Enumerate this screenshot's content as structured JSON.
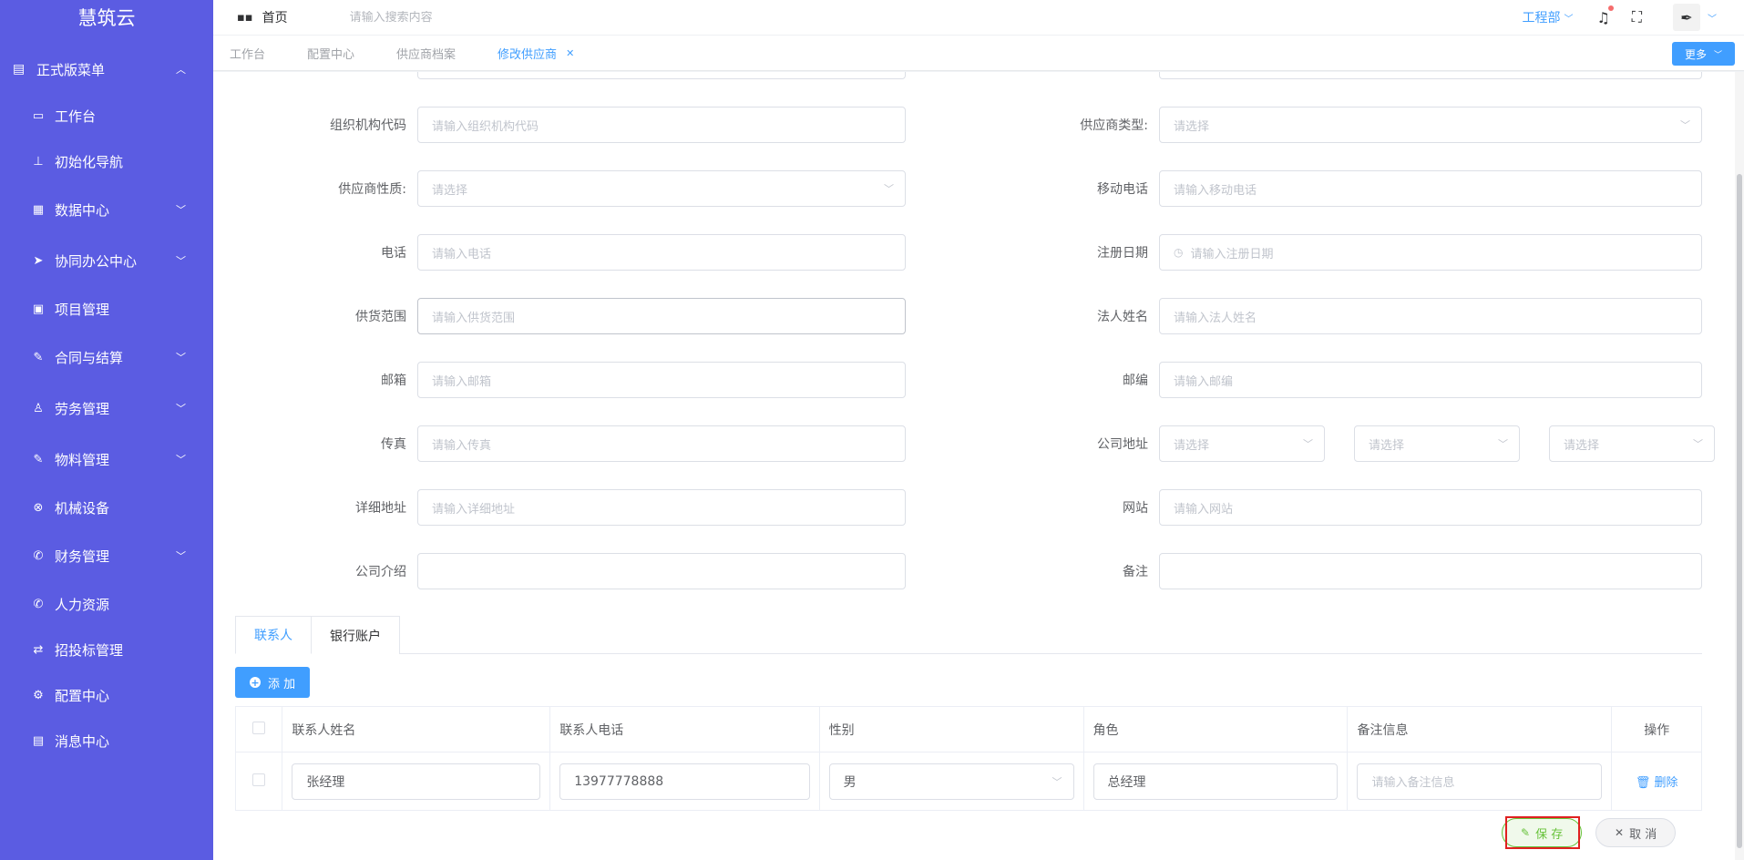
{
  "sidebar": {
    "logo": "慧筑云",
    "group": "正式版菜单",
    "items": [
      {
        "label": "工作台",
        "icon": "monitor-icon",
        "glyph": "▭",
        "arrow": false
      },
      {
        "label": "初始化导航",
        "icon": "sitemap-icon",
        "glyph": "⊥",
        "arrow": false
      },
      {
        "label": "数据中心",
        "icon": "grid-icon",
        "glyph": "▦",
        "arrow": true
      },
      {
        "label": "协同办公中心",
        "icon": "send-icon",
        "glyph": "➤",
        "arrow": true
      },
      {
        "label": "项目管理",
        "icon": "book-icon",
        "glyph": "▣",
        "arrow": false
      },
      {
        "label": "合同与结算",
        "icon": "edit-doc-icon",
        "glyph": "✎",
        "arrow": true
      },
      {
        "label": "劳务管理",
        "icon": "user-stamp-icon",
        "glyph": "♙",
        "arrow": true
      },
      {
        "label": "物料管理",
        "icon": "edit-icon",
        "glyph": "✎",
        "arrow": true
      },
      {
        "label": "机械设备",
        "icon": "circle-x-icon",
        "glyph": "⊗",
        "arrow": false
      },
      {
        "label": "财务管理",
        "icon": "phone-icon",
        "glyph": "✆",
        "arrow": true
      },
      {
        "label": "人力资源",
        "icon": "phone-call-icon",
        "glyph": "✆",
        "arrow": false
      },
      {
        "label": "招投标管理",
        "icon": "switch-icon",
        "glyph": "⇄",
        "arrow": false
      },
      {
        "label": "配置中心",
        "icon": "gear-icon",
        "glyph": "⚙",
        "arrow": false
      },
      {
        "label": "消息中心",
        "icon": "message-icon",
        "glyph": "▤",
        "arrow": false
      }
    ]
  },
  "header": {
    "home": "首页",
    "search_placeholder": "请输入搜索内容",
    "dept": "工程部"
  },
  "tabs": [
    {
      "label": "工作台",
      "active": false
    },
    {
      "label": "配置中心",
      "active": false
    },
    {
      "label": "供应商档案",
      "active": false
    },
    {
      "label": "修改供应商",
      "active": true
    }
  ],
  "more_label": "更多",
  "form": {
    "org_code": {
      "label": "组织机构代码",
      "placeholder": "请输入组织机构代码"
    },
    "supplier_type": {
      "label": "供应商类型:",
      "placeholder": "请选择"
    },
    "supplier_nature": {
      "label": "供应商性质:",
      "placeholder": "请选择"
    },
    "mobile": {
      "label": "移动电话",
      "placeholder": "请输入移动电话"
    },
    "phone": {
      "label": "电话",
      "placeholder": "请输入电话"
    },
    "reg_date": {
      "label": "注册日期",
      "placeholder": "请输入注册日期"
    },
    "supply_scope": {
      "label": "供货范围",
      "placeholder": "请输入供货范围"
    },
    "legal_name": {
      "label": "法人姓名",
      "placeholder": "请输入法人姓名"
    },
    "email": {
      "label": "邮箱",
      "placeholder": "请输入邮箱"
    },
    "zipcode": {
      "label": "邮编",
      "placeholder": "请输入邮编"
    },
    "fax": {
      "label": "传真",
      "placeholder": "请输入传真"
    },
    "company_address": {
      "label": "公司地址",
      "placeholder1": "请选择",
      "placeholder2": "请选择",
      "placeholder3": "请选择"
    },
    "detail_address": {
      "label": "详细地址",
      "placeholder": "请输入详细地址"
    },
    "website": {
      "label": "网站",
      "placeholder": "请输入网站"
    },
    "company_intro": {
      "label": "公司介绍",
      "value": ""
    },
    "remark": {
      "label": "备注",
      "value": ""
    }
  },
  "subtabs": [
    "联系人",
    "银行账户"
  ],
  "add_label": "添 加",
  "table": {
    "headers": [
      "联系人姓名",
      "联系人电话",
      "性别",
      "角色",
      "备注信息",
      "操作"
    ],
    "rows": [
      {
        "name": "张经理",
        "phone": "13977778888",
        "gender": "男",
        "role": "总经理",
        "remark_placeholder": "请输入备注信息",
        "action": "删除"
      }
    ]
  },
  "footer": {
    "save": "保 存",
    "cancel": "取 消"
  },
  "colors": {
    "sidebar": "#5b5ce2",
    "primary": "#409eff",
    "success": "#67c23a",
    "highlight": "#e02020"
  }
}
